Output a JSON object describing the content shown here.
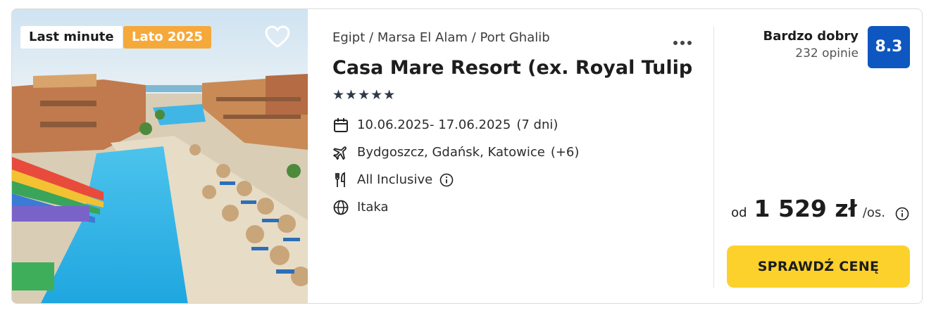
{
  "photo": {
    "badges": {
      "last_minute": "Last minute",
      "season": "Lato 2025"
    },
    "favorite_icon": "heart-outline-icon"
  },
  "details": {
    "breadcrumb": [
      "Egipt",
      "Marsa El Alam",
      "Port Ghalib"
    ],
    "breadcrumb_separator": "/",
    "more_icon": "more-horizontal-icon",
    "title": "Casa Mare Resort (ex. Royal Tulip Be…",
    "stars": "★★★★★",
    "star_rating": 5,
    "dates": {
      "text": "10.06.2025- 17.06.2025",
      "duration": "(7 dni)",
      "icon": "calendar-icon"
    },
    "airports": {
      "text": "Bydgoszcz, Gdańsk, Katowice",
      "more": "(+6)",
      "icon": "plane-icon"
    },
    "board": {
      "text": "All Inclusive",
      "icon": "cutlery-icon",
      "info_icon": "info-icon"
    },
    "operator": {
      "text": "Itaka",
      "icon": "globe-icon"
    }
  },
  "rating": {
    "label": "Bardzo dobry",
    "count": "232 opinie",
    "score": "8.3"
  },
  "price": {
    "prefix": "od",
    "amount": "1 529 zł",
    "per": "/os.",
    "info_icon": "info-icon"
  },
  "cta": {
    "label": "SPRAWDŹ CENĘ"
  },
  "colors": {
    "score_bg": "#0f57c0",
    "cta_bg": "#fdd12c",
    "season_badge_bg": "#f6a93b",
    "text": "#1d1d1d"
  }
}
